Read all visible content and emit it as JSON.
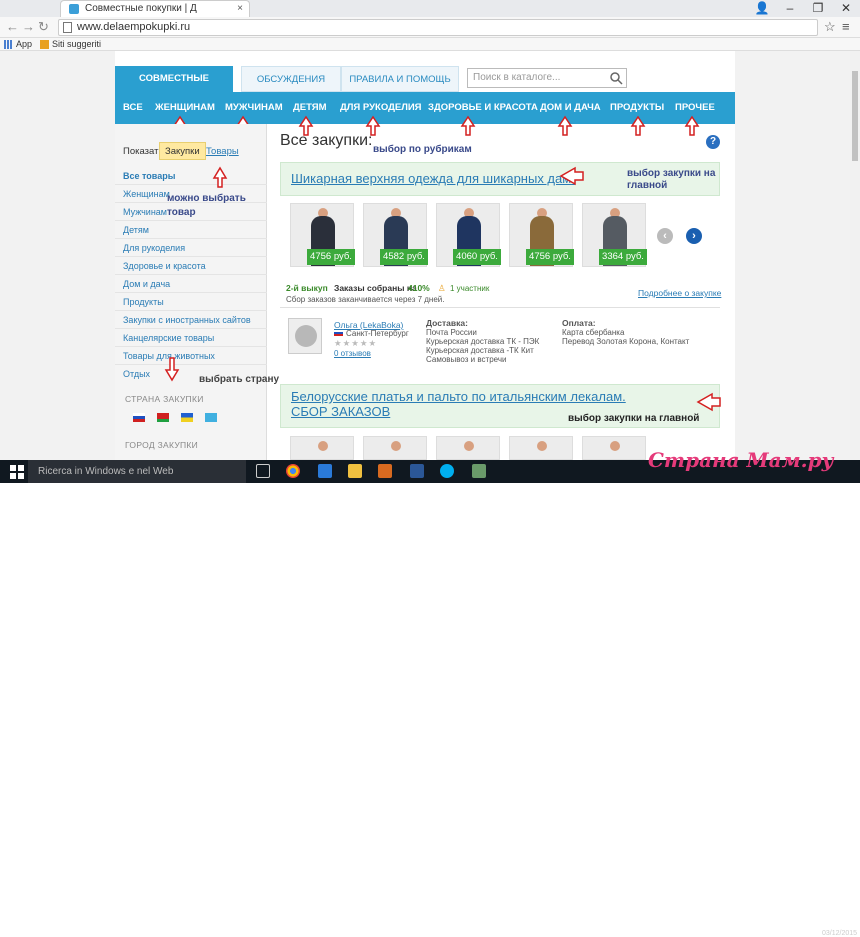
{
  "browser": {
    "tab_title": "Совместные покупки | Д",
    "url": "www.delaempokupki.ru",
    "bookmarks": [
      {
        "label": "App",
        "icon": "apps-grid-icon"
      },
      {
        "label": "Siti suggeriti",
        "icon": "bookmark-icon"
      }
    ]
  },
  "site": {
    "top_tabs": [
      "СОВМЕСТНЫЕ ПОКУПКИ:",
      "ОБСУЖДЕНИЯ",
      "ПРАВИЛА И ПОМОЩЬ"
    ],
    "search_placeholder": "Поиск в каталоге...",
    "categories": [
      "ВСЕ",
      "ЖЕНЩИНАМ",
      "МУЖЧИНАМ",
      "ДЕТЯМ",
      "ДЛЯ РУКОДЕЛИЯ",
      "ЗДОРОВЬЕ И КРАСОТА",
      "ДОМ И ДАЧА",
      "ПРОДУКТЫ",
      "ПРОЧЕЕ"
    ],
    "sidebar": {
      "show_label": "Показать:",
      "show_active": "Закупки",
      "show_goods": "Товары",
      "items": [
        "Все товары",
        "Женщинам",
        "Мужчинам",
        "Детям",
        "Для рукоделия",
        "Здоровье и красота",
        "Дом и дача",
        "Продукты",
        "Закупки с иностранных сайтов",
        "Канцелярские товары",
        "Товары для животных",
        "Отдых"
      ],
      "country_head": "СТРАНА ЗАКУПКИ",
      "city_head": "ГОРОД ЗАКУПКИ"
    },
    "main": {
      "heading": "Все закупки:",
      "card1": {
        "title": "Шикарная верхняя одежда для шикарных дам.",
        "prices": [
          "4756 руб.",
          "4582 руб.",
          "4060 руб.",
          "4756 руб.",
          "3364 руб."
        ],
        "issue": "2-й выкуп",
        "orders_label": "Заказы собраны на",
        "orders_pct": "410%",
        "participants": "1 участник",
        "ends": "Сбор заказов заканчивается через 7 дней.",
        "more_link": "Подробнее о закупке",
        "organizer": "Ольга (LekaBoka)",
        "city": "Санкт-Петербург",
        "reviews": "0 отзывов",
        "delivery_head": "Доставка:",
        "delivery": [
          "Почта России",
          "Курьерская доставка ТК - ПЭК",
          "Курьерская доставка -ТК Кит",
          "Самовывоз и встречи"
        ],
        "payment_head": "Оплата:",
        "payment": [
          "Карта сбербанка",
          "Перевод Золотая Корона, Контакт"
        ]
      },
      "card2": {
        "title": "Белорусские платья и пальто по итальянским лекалам. СБОР ЗАКАЗОВ"
      }
    },
    "annotations": {
      "by_rubric": "выбор по рубрикам",
      "choose_goods": "можно выбрать товар",
      "choose_purchase1": "выбор закупки на главной",
      "choose_country": "выбрать страну",
      "choose_purchase2": "выбор закупки на главной"
    }
  },
  "taskbar": {
    "search_placeholder": "Ricerca in Windows e nel Web",
    "apps": [
      "task-view-icon",
      "chrome-icon",
      "edge-icon",
      "explorer-icon",
      "media-icon",
      "word-icon",
      "skype-icon",
      "paint-icon"
    ]
  },
  "watermark": "Страна Мам.ру",
  "clock": "03/12/2015"
}
